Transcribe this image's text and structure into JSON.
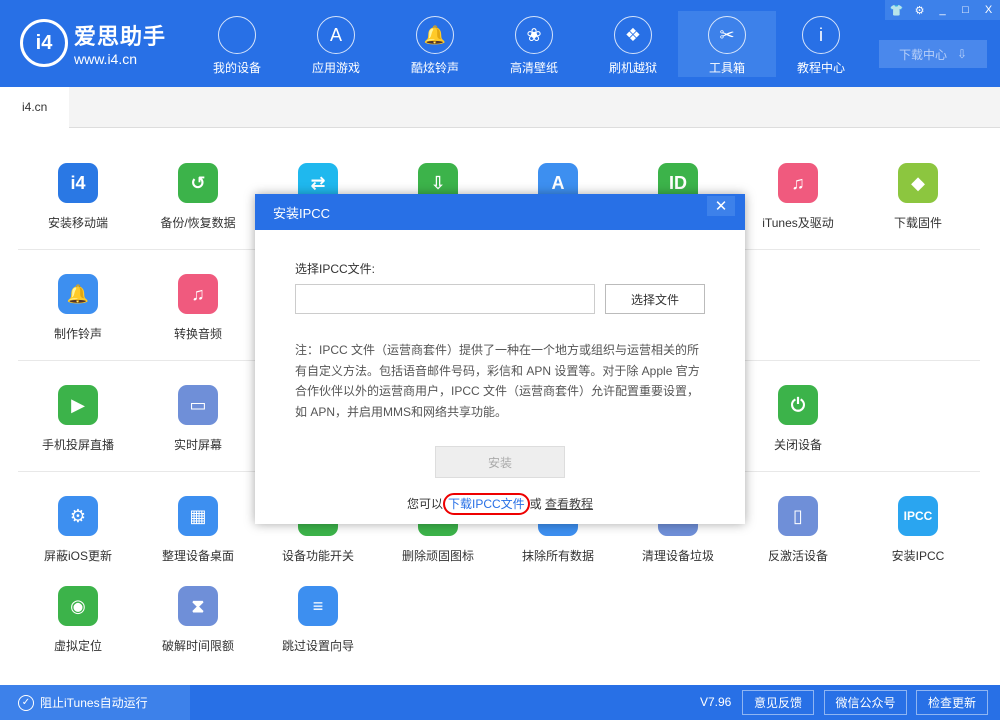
{
  "app": {
    "logo_name": "爱思助手",
    "logo_url": "www.i4.cn",
    "logo_mark": "i4"
  },
  "nav": [
    {
      "label": "我的设备",
      "icon": "apple-icon",
      "glyph": ""
    },
    {
      "label": "应用游戏",
      "icon": "app-store-icon",
      "glyph": "A"
    },
    {
      "label": "酷炫铃声",
      "icon": "bell-icon",
      "glyph": "🔔"
    },
    {
      "label": "高清壁纸",
      "icon": "flower-icon",
      "glyph": "❀"
    },
    {
      "label": "刷机越狱",
      "icon": "box-icon",
      "glyph": "❖"
    },
    {
      "label": "工具箱",
      "icon": "tools-icon",
      "glyph": "✂"
    },
    {
      "label": "教程中心",
      "icon": "info-icon",
      "glyph": "i"
    }
  ],
  "download_center": "下载中心",
  "tab": "i4.cn",
  "tools": [
    {
      "label": "安装移动端",
      "color": "#2a78e4",
      "glyph": "i4"
    },
    {
      "label": "备份/恢复数据",
      "color": "#3cb34a",
      "glyph": "↺"
    },
    {
      "label": "",
      "color": "#1fb8ee",
      "glyph": "⇄"
    },
    {
      "label": "",
      "color": "#3cb34a",
      "glyph": "⇩"
    },
    {
      "label": "",
      "color": "#3d8ff0",
      "glyph": "A"
    },
    {
      "label": "",
      "color": "#3cb34a",
      "glyph": "ID"
    },
    {
      "label": "iTunes及驱动",
      "color": "#f05a7e",
      "glyph": "♫"
    },
    {
      "label": "下载固件",
      "color": "#8cc63f",
      "glyph": "◆"
    },
    {
      "label": "制作铃声",
      "color": "#3d8ff0",
      "glyph": "🔔"
    },
    {
      "label": "转换音频",
      "color": "#f05a7e",
      "glyph": "♫"
    },
    {
      "label": "手机投屏直播",
      "color": "#3cb34a",
      "glyph": "▶"
    },
    {
      "label": "实时屏幕",
      "color": "#6f8fd8",
      "glyph": "▭"
    },
    {
      "label": "关闭设备",
      "color": "#3cb34a",
      "glyph": "⏻"
    },
    {
      "label": "屏蔽iOS更新",
      "color": "#3d8ff0",
      "glyph": "⚙"
    },
    {
      "label": "整理设备桌面",
      "color": "#3d8ff0",
      "glyph": "▦"
    },
    {
      "label": "设备功能开关",
      "color": "#3cb34a",
      "glyph": "⇆"
    },
    {
      "label": "删除顽固图标",
      "color": "#3cb34a",
      "glyph": "✕"
    },
    {
      "label": "抹除所有数据",
      "color": "#3d8ff0",
      "glyph": "⌫"
    },
    {
      "label": "清理设备垃圾",
      "color": "#6f8fd8",
      "glyph": "✎"
    },
    {
      "label": "反激活设备",
      "color": "#6f8fd8",
      "glyph": "▯"
    },
    {
      "label": "安装IPCC",
      "color": "#2aa5f0",
      "glyph": "IPCC"
    },
    {
      "label": "虚拟定位",
      "color": "#3cb34a",
      "glyph": "◉"
    },
    {
      "label": "破解时间限额",
      "color": "#6f8fd8",
      "glyph": "⧗"
    },
    {
      "label": "跳过设置向导",
      "color": "#3d8ff0",
      "glyph": "≡"
    }
  ],
  "modal": {
    "title": "安装IPCC",
    "file_label": "选择IPCC文件:",
    "file_value": "",
    "choose_button": "选择文件",
    "note": "注：IPCC 文件（运营商套件）提供了一种在一个地方或组织与运营相关的所有自定义方法。包括语音邮件号码，彩信和 APN 设置等。对于除 Apple 官方合作伙伴以外的运营商用户，IPCC 文件（运营商套件）允许配置重要设置，如 APN，并启用MMS和网络共享功能。",
    "install_button": "安装",
    "footer_prefix": "您可以",
    "download_link": "下载IPCC文件",
    "footer_or": "或",
    "tutorial_link": "查看教程"
  },
  "bottom": {
    "itunes_block": "阻止iTunes自动运行",
    "version": "V7.96",
    "feedback": "意见反馈",
    "wechat": "微信公众号",
    "check_update": "检查更新"
  }
}
